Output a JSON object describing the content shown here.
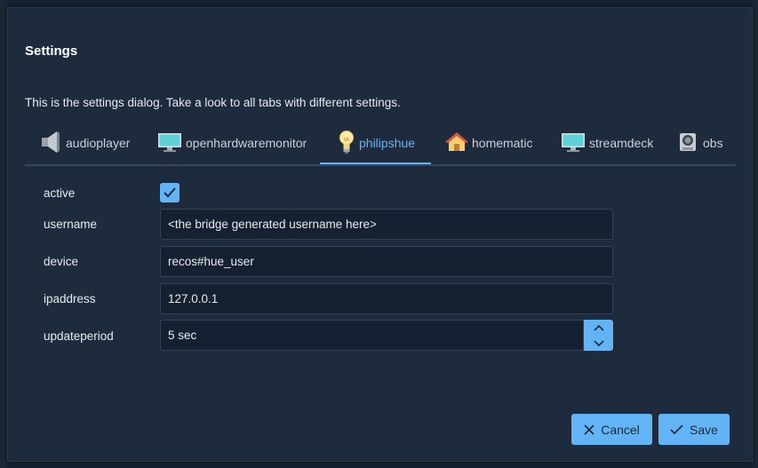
{
  "dialog": {
    "title": "Settings",
    "description": "This is the settings dialog. Take a look to all tabs with different settings."
  },
  "tabs": [
    {
      "label": "audioplayer",
      "icon": "speaker-icon"
    },
    {
      "label": "openhardwaremonitor",
      "icon": "monitor-icon"
    },
    {
      "label": "philipshue",
      "icon": "lightbulb-icon",
      "active": true
    },
    {
      "label": "homematic",
      "icon": "house-icon"
    },
    {
      "label": "streamdeck",
      "icon": "monitor-icon"
    },
    {
      "label": "obs",
      "icon": "camera-icon"
    }
  ],
  "form": {
    "active_label": "active",
    "active_checked": true,
    "username_label": "username",
    "username_value": "<the bridge generated username here>",
    "device_label": "device",
    "device_value": "recos#hue_user",
    "ipaddress_label": "ipaddress",
    "ipaddress_value": "127.0.0.1",
    "updateperiod_label": "updateperiod",
    "updateperiod_value": "5 sec"
  },
  "buttons": {
    "cancel_label": "Cancel",
    "save_label": "Save"
  },
  "colors": {
    "accent": "#63b4f5",
    "dialog_bg": "#1e2b3d",
    "input_bg": "#152030"
  }
}
